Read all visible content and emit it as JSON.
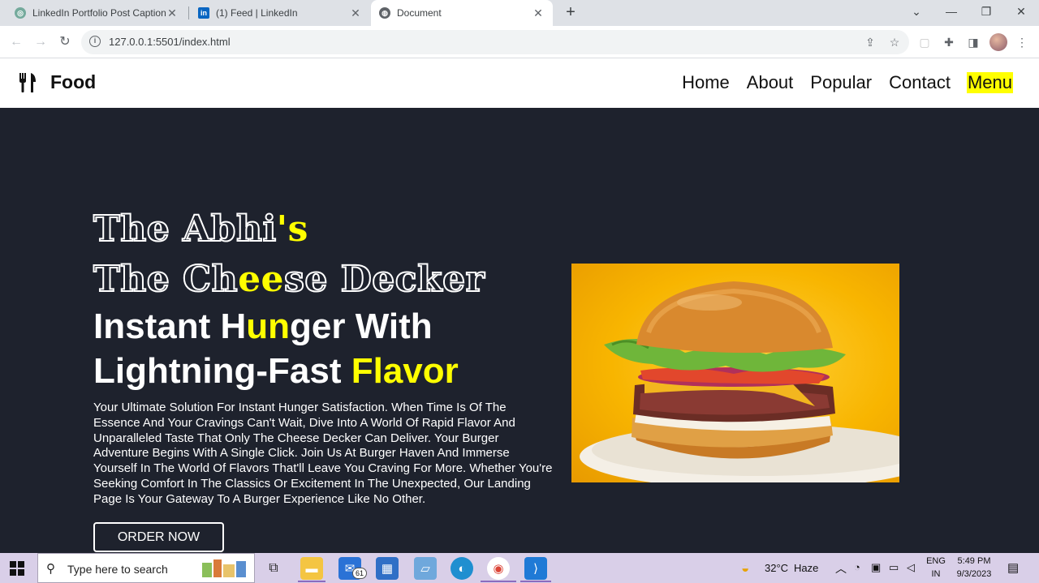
{
  "browser": {
    "tabs": [
      {
        "title": "LinkedIn Portfolio Post Caption",
        "icon": "chatgpt-icon",
        "active": false
      },
      {
        "title": "(1) Feed | LinkedIn",
        "icon": "linkedin-icon",
        "active": false
      },
      {
        "title": "Document",
        "icon": "globe-icon",
        "active": true
      }
    ],
    "tab_close": "✕",
    "new_tab": "+",
    "url": "127.0.0.1:5501/index.html"
  },
  "site": {
    "brand": "Food",
    "nav": {
      "home": "Home",
      "about": "About",
      "popular": "Popular",
      "contact": "Contact",
      "menu": "Menu"
    },
    "hero": {
      "line1_a": "The Abhi",
      "line1_b": "'s",
      "line2_a": "The Ch",
      "line2_b": "ee",
      "line2_c": "se Decker",
      "line3_a": "Instant H",
      "line3_b": "un",
      "line3_c": "ger With",
      "line4_a": "Lightning-Fast ",
      "line4_b": "Flavor",
      "description": "Your Ultimate Solution For Instant Hunger Satisfaction. When Time Is Of The Essence And Your Cravings Can't Wait, Dive Into A World Of Rapid Flavor And Unparalleled Taste That Only The Cheese Decker Can Deliver. Your Burger Adventure Begins With A Single Click. Join Us At Burger Haven And Immerse Yourself In The World Of Flavors That'll Leave You Craving For More. Whether You're Seeking Comfort In The Classics Or Excitement In The Unexpected, Our Landing Page Is Your Gateway To A Burger Experience Like No Other.",
      "cta": "ORDER NOW"
    },
    "accent": "#ffff00",
    "background": "#1e222d"
  },
  "taskbar": {
    "search_placeholder": "Type here to search",
    "mail_badge": "61",
    "weather_temp": "32°C",
    "weather_desc": "Haze",
    "lang_top": "ENG",
    "lang_bottom": "IN",
    "time": "5:49 PM",
    "date": "9/3/2023"
  }
}
